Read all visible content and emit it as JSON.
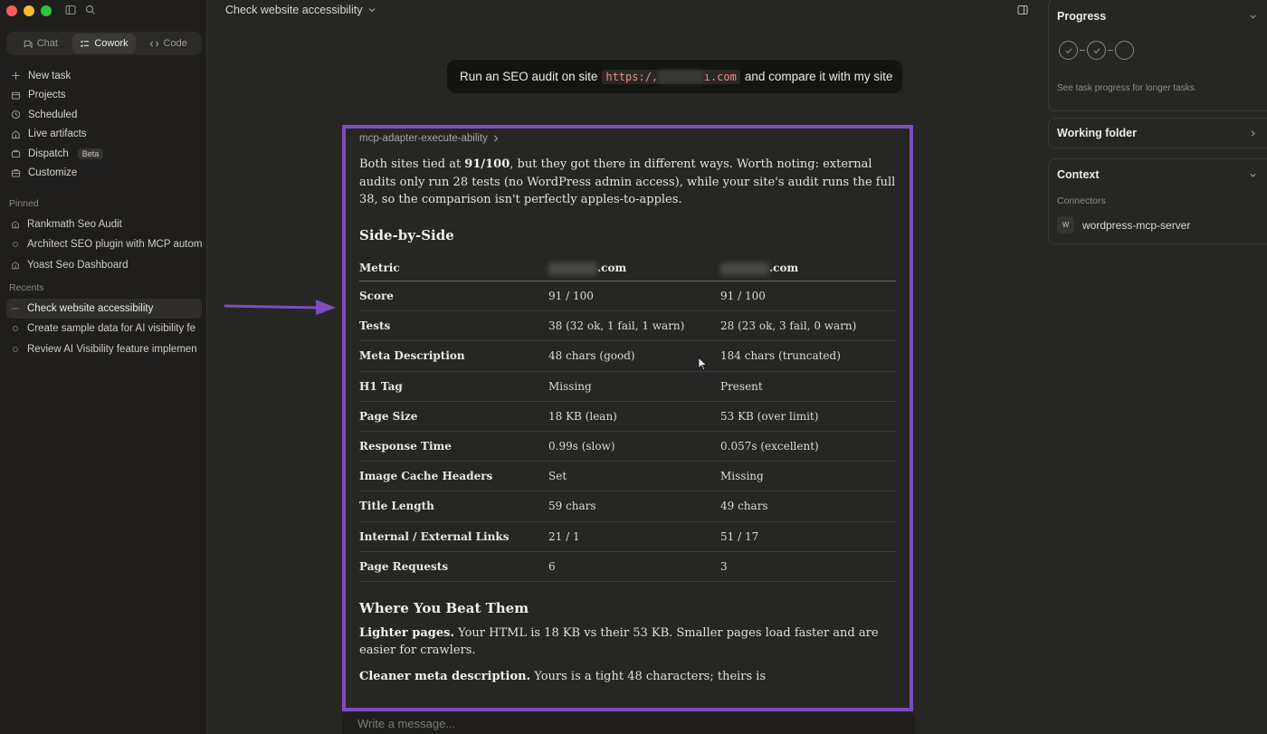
{
  "window": {
    "traffic_lights": [
      "close",
      "minimize",
      "zoom"
    ],
    "icons": [
      "sidebar-toggle-icon",
      "search-icon"
    ]
  },
  "modes": [
    {
      "label": "Chat",
      "icon": "chat-icon",
      "active": false
    },
    {
      "label": "Cowork",
      "icon": "cowork-icon",
      "active": true
    },
    {
      "label": "Code",
      "icon": "code-icon",
      "active": false
    }
  ],
  "nav": {
    "new_task": "New task",
    "projects": "Projects",
    "scheduled": "Scheduled",
    "live_artifacts": "Live artifacts",
    "dispatch": "Dispatch",
    "dispatch_badge": "Beta",
    "customize": "Customize"
  },
  "pinned": {
    "label": "Pinned",
    "items": [
      "Rankmath Seo Audit",
      "Architect SEO plugin with MCP autom",
      "Yoast Seo Dashboard"
    ]
  },
  "recents": {
    "label": "Recents",
    "items": [
      "Check website accessibility",
      "Create sample data for AI visibility fe",
      "Review AI Visibility feature implemen"
    ]
  },
  "topbar": {
    "title": "Check website accessibility"
  },
  "user_message": {
    "before": "Run an SEO audit on site",
    "code": "https:/,",
    "code_tail": "ı.com",
    "after": "and compare it with my site"
  },
  "response": {
    "tool": "mcp-adapter-execute-ability",
    "intro_pre": "Both sites tied at ",
    "intro_score": "91/100",
    "intro_post": ", but they got there in different ways. Worth noting: external audits only run 28 tests (no WordPress admin access), while your site's audit runs the full 38, so the comparison isn't perfectly apples-to-apples.",
    "side_heading": "Side-by-Side",
    "table": {
      "headers": [
        "Metric",
        ".com",
        ".com"
      ],
      "rows": [
        [
          "Score",
          "91 / 100",
          "91 / 100"
        ],
        [
          "Tests",
          "38 (32 ok, 1 fail, 1 warn)",
          "28 (23 ok, 3 fail, 0 warn)"
        ],
        [
          "Meta Description",
          "48 chars (good)",
          "184 chars (truncated)"
        ],
        [
          "H1 Tag",
          "Missing",
          "Present"
        ],
        [
          "Page Size",
          "18 KB (lean)",
          "53 KB (over limit)"
        ],
        [
          "Response Time",
          "0.99s (slow)",
          "0.057s (excellent)"
        ],
        [
          "Image Cache Headers",
          "Set",
          "Missing"
        ],
        [
          "Title Length",
          "59 chars",
          "49 chars"
        ],
        [
          "Internal / External Links",
          "21 / 1",
          "51 / 17"
        ],
        [
          "Page Requests",
          "6",
          "3"
        ]
      ]
    },
    "beat_heading": "Where You Beat Them",
    "p1_bold": "Lighter pages.",
    "p1_text": " Your HTML is 18 KB vs their 53 KB. Smaller pages load faster and are easier for crawlers.",
    "p2_bold": "Cleaner meta description.",
    "p2_text": " Yours is a tight 48 characters; theirs is"
  },
  "composer": {
    "placeholder": "Write a message..."
  },
  "right_panel": {
    "progress_title": "Progress",
    "progress_steps": [
      "done",
      "done",
      "pending"
    ],
    "progress_note": "See task progress for longer tasks.",
    "working_folder": "Working folder",
    "context_title": "Context",
    "connectors_label": "Connectors",
    "connector_initial": "W",
    "connector_name": "wordpress-mcp-server"
  },
  "colors": {
    "highlight_border": "#7c4dbf",
    "arrow": "#7c4dbf",
    "code_text": "#f28b82"
  }
}
